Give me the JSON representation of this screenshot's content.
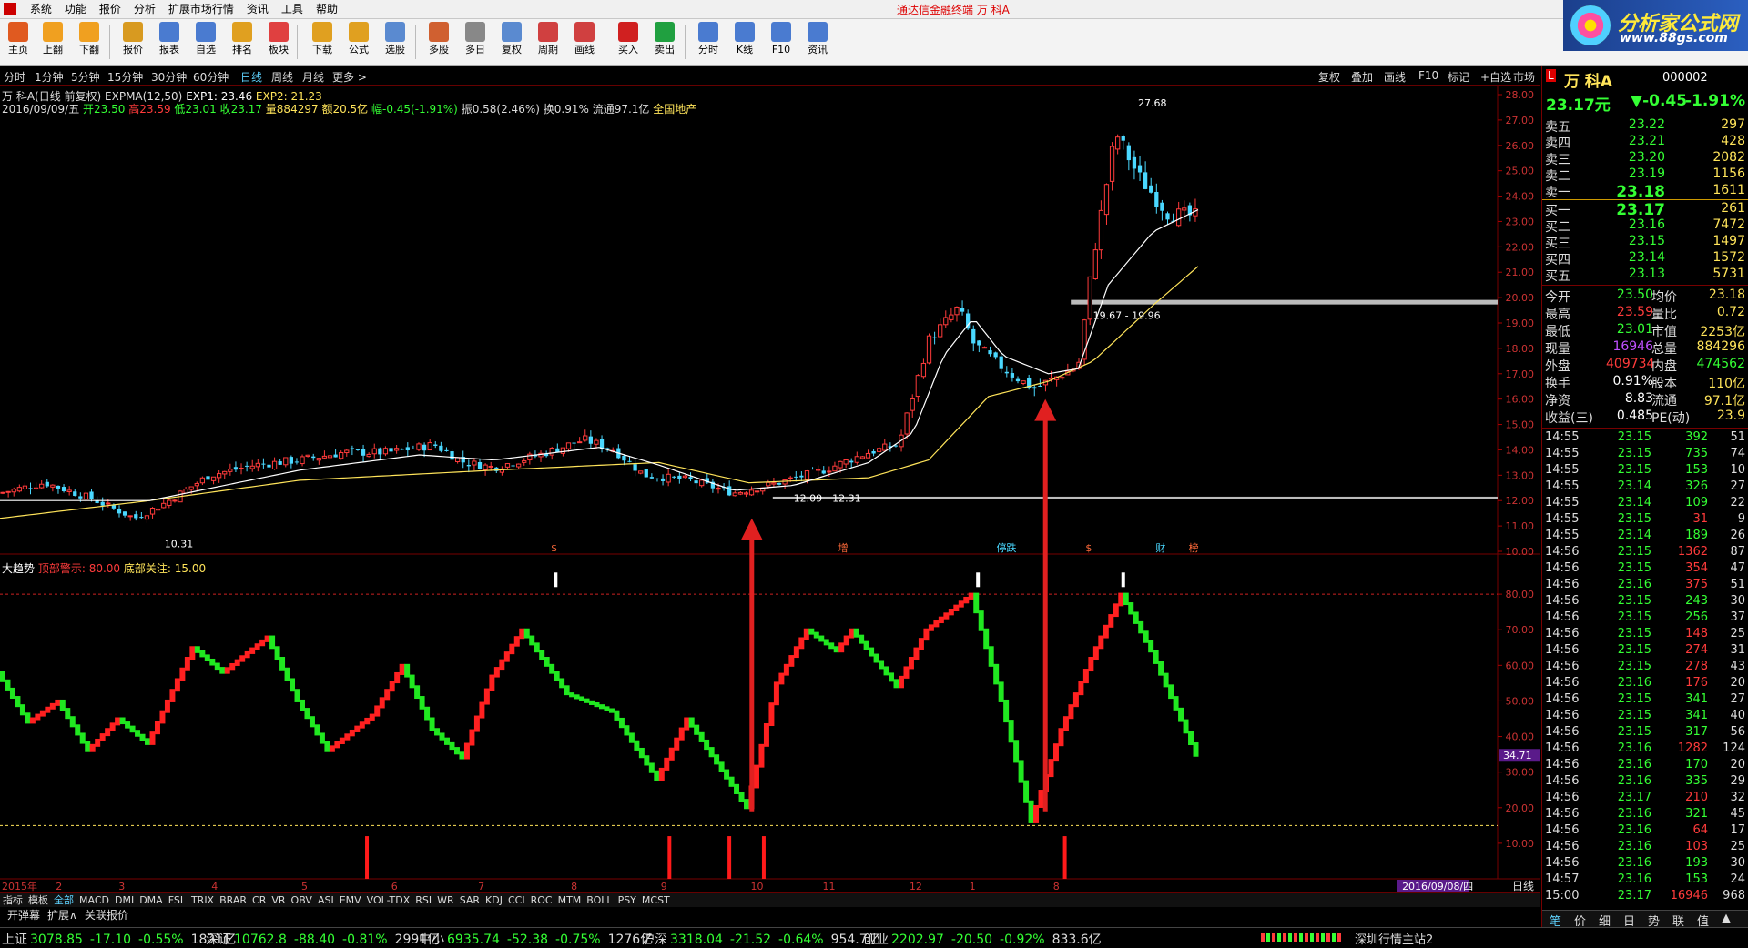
{
  "menu": {
    "items": [
      "系统",
      "功能",
      "报价",
      "分析",
      "扩展市场行情",
      "资讯",
      "工具",
      "帮助"
    ],
    "window_title": "通达信金融终端   万 科A"
  },
  "toolbar": {
    "buttons": [
      {
        "label": "主页",
        "color": "#e05a20",
        "icon": "home-icon"
      },
      {
        "label": "上翻",
        "color": "#f0a020",
        "icon": "arrow-up-icon"
      },
      {
        "label": "下翻",
        "color": "#f0a020",
        "icon": "arrow-down-icon"
      },
      {
        "label": "报价",
        "color": "#d89a20",
        "icon": "quote-icon"
      },
      {
        "label": "报表",
        "color": "#4a7bd0",
        "icon": "report-icon"
      },
      {
        "label": "自选",
        "color": "#4a7bd0",
        "icon": "f6-icon"
      },
      {
        "label": "排名",
        "color": "#e0a020",
        "icon": "rank-icon"
      },
      {
        "label": "板块",
        "color": "#e04040",
        "icon": "sector-icon"
      },
      {
        "label": "下载",
        "color": "#e0a020",
        "icon": "download-icon"
      },
      {
        "label": "公式",
        "color": "#e0a020",
        "icon": "formula-icon"
      },
      {
        "label": "选股",
        "color": "#5a8ad0",
        "icon": "pick-stock-icon"
      },
      {
        "label": "多股",
        "color": "#d06030",
        "icon": "multi-stock-icon"
      },
      {
        "label": "多日",
        "color": "#888888",
        "icon": "multi-day-icon"
      },
      {
        "label": "复权",
        "color": "#5a8ad0",
        "icon": "restore-icon"
      },
      {
        "label": "周期",
        "color": "#d04040",
        "icon": "f8-icon"
      },
      {
        "label": "画线",
        "color": "#d04040",
        "icon": "draw-line-icon"
      },
      {
        "label": "买入",
        "color": "#d02020",
        "icon": "buy-icon"
      },
      {
        "label": "卖出",
        "color": "#20a040",
        "icon": "sell-icon"
      },
      {
        "label": "分时",
        "color": "#4a7bd0",
        "icon": "intraday-icon"
      },
      {
        "label": "K线",
        "color": "#4a7bd0",
        "icon": "kline-icon"
      },
      {
        "label": "F10",
        "color": "#4a7bd0",
        "icon": "f10-icon"
      },
      {
        "label": "资讯",
        "color": "#4a7bd0",
        "icon": "news-icon"
      }
    ]
  },
  "brand": {
    "name": "分析家公式网",
    "url": "www.88gs.com"
  },
  "periods": {
    "items": [
      "分时",
      "1分钟",
      "5分钟",
      "15分钟",
      "30分钟",
      "60分钟",
      "日线",
      "周线",
      "月线",
      "更多 >"
    ],
    "active": "日线",
    "right_tools": [
      "复权",
      "叠加",
      "画线",
      "F10",
      "标记",
      "+自选",
      "市场"
    ]
  },
  "chart_info": {
    "line1_prefix": "万 科A(日线 前复权)",
    "line1_exp": "EXPMA(12,50)",
    "exp1_label": "EXP1: 23.46",
    "exp2_label": "EXP2: 21.23",
    "date": "2016/09/09/五",
    "open": "开23.50",
    "high": "高23.59",
    "low": "低23.01",
    "close": "收23.17",
    "volume": "量884297",
    "amount": "额20.5亿",
    "change": "幅-0.45(-1.91%)",
    "amplitude": "振0.58(2.46%)",
    "turnover": "换0.91%",
    "float": "流通97.1亿",
    "sector": "全国地产"
  },
  "indicator": {
    "name": "大趋势",
    "top_label": "顶部警示: 80.00",
    "bottom_label": "底部关注: 15.00",
    "current_value": "34.71"
  },
  "chart_data": {
    "type": "candlestick",
    "price_axis": {
      "ylim": [
        10.0,
        28.0
      ],
      "ticks": [
        "28.00",
        "27.00",
        "26.00",
        "25.00",
        "24.00",
        "23.00",
        "22.00",
        "21.00",
        "20.00",
        "19.00",
        "18.00",
        "17.00",
        "16.00",
        "15.00",
        "14.00",
        "13.00",
        "12.00",
        "11.00",
        "10.00"
      ]
    },
    "indicator_axis": {
      "ylim": [
        0,
        90
      ],
      "ticks": [
        "80.00",
        "70.00",
        "60.00",
        "50.00",
        "40.00",
        "30.00",
        "20.00",
        "10.00"
      ]
    },
    "x_labels": [
      {
        "label": "2015年",
        "pos": 0.0
      },
      {
        "label": "2",
        "pos": 0.036
      },
      {
        "label": "3",
        "pos": 0.078
      },
      {
        "label": "4",
        "pos": 0.14
      },
      {
        "label": "5",
        "pos": 0.2
      },
      {
        "label": "6",
        "pos": 0.26
      },
      {
        "label": "7",
        "pos": 0.318
      },
      {
        "label": "8",
        "pos": 0.38
      },
      {
        "label": "9",
        "pos": 0.44
      },
      {
        "label": "10",
        "pos": 0.5
      },
      {
        "label": "11",
        "pos": 0.548
      },
      {
        "label": "12",
        "pos": 0.606
      },
      {
        "label": "1",
        "pos": 0.646
      },
      {
        "label": "8",
        "pos": 0.702
      },
      {
        "label": "2016/09/08/四",
        "pos": 0.935
      }
    ],
    "annotations": [
      "10.31",
      "12.09 - 12.31",
      "19.67 - 19.96",
      "27.68"
    ],
    "event_marks": [
      "$",
      "增",
      "停跌",
      "$",
      "财",
      "榜"
    ],
    "close_anchors": [
      [
        0,
        12.3
      ],
      [
        0.03,
        12.7
      ],
      [
        0.06,
        12.1
      ],
      [
        0.09,
        11.3
      ],
      [
        0.11,
        11.9
      ],
      [
        0.14,
        13.0
      ],
      [
        0.17,
        13.4
      ],
      [
        0.2,
        13.6
      ],
      [
        0.23,
        13.9
      ],
      [
        0.26,
        13.9
      ],
      [
        0.29,
        14.2
      ],
      [
        0.31,
        13.5
      ],
      [
        0.33,
        13.3
      ],
      [
        0.36,
        13.8
      ],
      [
        0.39,
        14.4
      ],
      [
        0.41,
        14.0
      ],
      [
        0.43,
        13.0
      ],
      [
        0.46,
        12.8
      ],
      [
        0.49,
        12.3
      ],
      [
        0.52,
        12.7
      ],
      [
        0.55,
        13.2
      ],
      [
        0.58,
        13.9
      ],
      [
        0.6,
        14.2
      ],
      [
        0.62,
        18.3
      ],
      [
        0.64,
        19.6
      ],
      [
        0.65,
        18.2
      ],
      [
        0.67,
        17.2
      ],
      [
        0.69,
        16.4
      ],
      [
        0.72,
        17.3
      ],
      [
        0.73,
        21.6
      ],
      [
        0.745,
        26.5
      ],
      [
        0.76,
        24.8
      ],
      [
        0.78,
        23.3
      ],
      [
        0.8,
        23.2
      ]
    ],
    "ema_fast_anchors": [
      [
        0,
        12.0
      ],
      [
        0.1,
        12.0
      ],
      [
        0.2,
        13.2
      ],
      [
        0.28,
        13.8
      ],
      [
        0.33,
        13.6
      ],
      [
        0.4,
        14.1
      ],
      [
        0.44,
        13.4
      ],
      [
        0.49,
        12.4
      ],
      [
        0.53,
        12.6
      ],
      [
        0.58,
        13.5
      ],
      [
        0.61,
        14.7
      ],
      [
        0.63,
        17.7
      ],
      [
        0.65,
        19.2
      ],
      [
        0.67,
        17.7
      ],
      [
        0.7,
        17.0
      ],
      [
        0.72,
        17.2
      ],
      [
        0.74,
        20.5
      ],
      [
        0.77,
        22.6
      ],
      [
        0.8,
        23.46
      ]
    ],
    "ema_slow_anchors": [
      [
        0,
        11.3
      ],
      [
        0.1,
        12.0
      ],
      [
        0.2,
        12.8
      ],
      [
        0.33,
        13.2
      ],
      [
        0.44,
        13.5
      ],
      [
        0.5,
        12.7
      ],
      [
        0.58,
        12.9
      ],
      [
        0.62,
        13.6
      ],
      [
        0.66,
        16.1
      ],
      [
        0.7,
        16.7
      ],
      [
        0.73,
        17.5
      ],
      [
        0.77,
        19.7
      ],
      [
        0.8,
        21.23
      ]
    ],
    "indicator_anchors": [
      [
        0,
        58
      ],
      [
        0.02,
        44
      ],
      [
        0.04,
        50
      ],
      [
        0.06,
        36
      ],
      [
        0.08,
        45
      ],
      [
        0.1,
        38
      ],
      [
        0.13,
        65
      ],
      [
        0.15,
        58
      ],
      [
        0.18,
        68
      ],
      [
        0.2,
        50
      ],
      [
        0.22,
        36
      ],
      [
        0.25,
        46
      ],
      [
        0.27,
        60
      ],
      [
        0.29,
        42
      ],
      [
        0.31,
        34
      ],
      [
        0.33,
        57
      ],
      [
        0.35,
        70
      ],
      [
        0.38,
        52
      ],
      [
        0.41,
        47
      ],
      [
        0.44,
        28
      ],
      [
        0.46,
        45
      ],
      [
        0.5,
        20
      ],
      [
        0.52,
        55
      ],
      [
        0.54,
        70
      ],
      [
        0.56,
        64
      ],
      [
        0.57,
        70
      ],
      [
        0.6,
        54
      ],
      [
        0.62,
        70
      ],
      [
        0.65,
        80
      ],
      [
        0.67,
        50
      ],
      [
        0.69,
        16
      ],
      [
        0.71,
        42
      ],
      [
        0.73,
        62
      ],
      [
        0.75,
        80
      ],
      [
        0.77,
        64
      ],
      [
        0.8,
        34.71
      ]
    ],
    "top_threshold": 80.0,
    "bottom_threshold": 15.0,
    "white_markers": [
      0.371,
      0.653,
      0.75
    ],
    "red_bars": [
      0.245,
      0.447,
      0.487,
      0.51,
      0.711
    ],
    "arrows": [
      0.502,
      0.698
    ]
  },
  "indicator_tabs": {
    "items": [
      "指标",
      "模板",
      "全部",
      "MACD",
      "DMI",
      "DMA",
      "FSL",
      "TRIX",
      "BRAR",
      "CR",
      "VR",
      "OBV",
      "ASI",
      "EMV",
      "VOL-TDX",
      "RSI",
      "WR",
      "SAR",
      "KDJ",
      "CCI",
      "ROC",
      "MTM",
      "BOLL",
      "PSY",
      "MCST"
    ],
    "selected": "全部"
  },
  "bottom_tabs": [
    "开弹幕",
    "扩展∧",
    "关联报价"
  ],
  "bottom_right": "日线",
  "quote": {
    "name": "万 科A",
    "code": "000002",
    "price": "23.17元",
    "change": "▼-0.45",
    "pct": "-1.91%",
    "sells": [
      [
        "卖五",
        "23.22",
        "297"
      ],
      [
        "卖四",
        "23.21",
        "428"
      ],
      [
        "卖三",
        "23.20",
        "2082"
      ],
      [
        "卖二",
        "23.19",
        "1156"
      ],
      [
        "卖一",
        "23.18",
        "1611"
      ]
    ],
    "buys": [
      [
        "买一",
        "23.17",
        "261"
      ],
      [
        "买二",
        "23.16",
        "7472"
      ],
      [
        "买三",
        "23.15",
        "1497"
      ],
      [
        "买四",
        "23.14",
        "1572"
      ],
      [
        "买五",
        "23.13",
        "5731"
      ]
    ],
    "stats": [
      [
        "今开",
        "23.50",
        "均价",
        "23.18"
      ],
      [
        "最高",
        "23.59",
        "量比",
        "0.72"
      ],
      [
        "最低",
        "23.01",
        "市值",
        "2253亿"
      ],
      [
        "现量",
        "16946",
        "总量",
        "884296"
      ],
      [
        "外盘",
        "409734",
        "内盘",
        "474562"
      ],
      [
        "换手",
        "0.91%",
        "股本",
        "110亿"
      ],
      [
        "净资",
        "8.83",
        "流通",
        "97.1亿"
      ],
      [
        "收益(三)",
        "0.485",
        "PE(动)",
        "23.9"
      ]
    ],
    "ticks": [
      [
        "14:55",
        "23.15",
        "392",
        "51",
        "d"
      ],
      [
        "14:55",
        "23.15",
        "735",
        "74",
        "d"
      ],
      [
        "14:55",
        "23.15",
        "153",
        "10",
        "d"
      ],
      [
        "14:55",
        "23.14",
        "326",
        "27",
        "d"
      ],
      [
        "14:55",
        "23.14",
        "109",
        "22",
        "d"
      ],
      [
        "14:55",
        "23.15",
        "31",
        "9",
        "u"
      ],
      [
        "14:55",
        "23.14",
        "189",
        "26",
        "d"
      ],
      [
        "14:56",
        "23.15",
        "1362",
        "87",
        "u"
      ],
      [
        "14:56",
        "23.15",
        "354",
        "47",
        "u"
      ],
      [
        "14:56",
        "23.16",
        "375",
        "51",
        "u"
      ],
      [
        "14:56",
        "23.15",
        "243",
        "30",
        "d"
      ],
      [
        "14:56",
        "23.15",
        "256",
        "37",
        "d"
      ],
      [
        "14:56",
        "23.15",
        "148",
        "25",
        "u"
      ],
      [
        "14:56",
        "23.15",
        "274",
        "31",
        "u"
      ],
      [
        "14:56",
        "23.15",
        "278",
        "43",
        "u"
      ],
      [
        "14:56",
        "23.16",
        "176",
        "20",
        "u"
      ],
      [
        "14:56",
        "23.15",
        "341",
        "27",
        "d"
      ],
      [
        "14:56",
        "23.15",
        "341",
        "40",
        "d"
      ],
      [
        "14:56",
        "23.15",
        "317",
        "56",
        "d"
      ],
      [
        "14:56",
        "23.16",
        "1282",
        "124",
        "u"
      ],
      [
        "14:56",
        "23.16",
        "170",
        "20",
        "d"
      ],
      [
        "14:56",
        "23.16",
        "335",
        "29",
        "d"
      ],
      [
        "14:56",
        "23.17",
        "210",
        "32",
        "u"
      ],
      [
        "14:56",
        "23.16",
        "321",
        "45",
        "d"
      ],
      [
        "14:56",
        "23.16",
        "64",
        "17",
        "u"
      ],
      [
        "14:56",
        "23.16",
        "103",
        "25",
        "u"
      ],
      [
        "14:56",
        "23.16",
        "193",
        "30",
        "d"
      ],
      [
        "14:57",
        "23.16",
        "153",
        "24",
        "d"
      ],
      [
        "15:00",
        "23.17",
        "16946",
        "968",
        "u"
      ]
    ],
    "tabs": [
      "笔",
      "价",
      "细",
      "日",
      "势",
      "联",
      "值",
      "▲"
    ]
  },
  "status": {
    "items": [
      {
        "name": "上证",
        "price": "3078.85",
        "chg": "-17.10",
        "pct": "-0.55%",
        "amt": "1821亿"
      },
      {
        "name": "深证",
        "price": "10762.8",
        "chg": "-88.40",
        "pct": "-0.81%",
        "amt": "2991亿"
      },
      {
        "name": "中小",
        "price": "6935.74",
        "chg": "-52.38",
        "pct": "-0.75%",
        "amt": "1276亿"
      },
      {
        "name": "沪深",
        "price": "3318.04",
        "chg": "-21.52",
        "pct": "-0.64%",
        "amt": "954.7亿"
      },
      {
        "name": "创业",
        "price": "2202.97",
        "chg": "-20.50",
        "pct": "-0.92%",
        "amt": "833.6亿"
      }
    ],
    "server": "深圳行情主站2"
  },
  "colors": {
    "up": "#ff3b3b",
    "down": "#34ff34",
    "ema1": "#ffffff",
    "ema2": "#ffe45a",
    "grid_red": "#700000"
  }
}
